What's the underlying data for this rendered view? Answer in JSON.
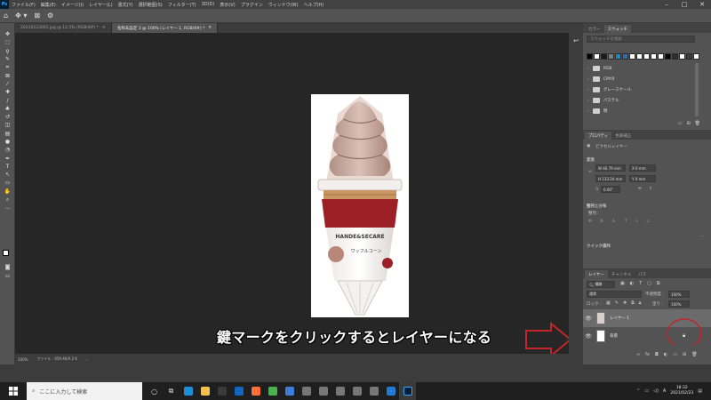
{
  "app": {
    "logo": "Ps"
  },
  "menu": [
    "ファイル(F)",
    "編集(E)",
    "イメージ(I)",
    "レイヤー(L)",
    "書式(Y)",
    "選択範囲(S)",
    "フィルター(T)",
    "3D(D)",
    "表示(V)",
    "プラグイン",
    "ウィンドウ(W)",
    "ヘルプ(H)"
  ],
  "tabs": [
    {
      "label": "20210223001.jpg @ 12.5% (RGB/8#) *",
      "active": false
    },
    {
      "label": "名称未設定 3 @ 100% (レイヤー 1, RGB/8#) *",
      "active": true
    }
  ],
  "toolbar_icons": [
    "move-icon",
    "marquee-icon",
    "lasso-icon",
    "quick-select-icon",
    "crop-icon",
    "frame-icon",
    "eyedropper-icon",
    "healing-icon",
    "brush-icon",
    "stamp-icon",
    "history-brush-icon",
    "eraser-icon",
    "gradient-icon",
    "blur-icon",
    "dodge-icon",
    "pen-icon",
    "type-icon",
    "path-select-icon",
    "rectangle-icon",
    "hand-icon",
    "zoom-icon",
    "more-tools-icon"
  ],
  "status": {
    "zoom": "100%",
    "file_info": "ファイル : 459.4K/0.2 K"
  },
  "swatches_panel": {
    "tabs": [
      "カラー",
      "スウォッチ"
    ],
    "search_placeholder": "スウォッチを検索",
    "colors": [
      "#000000",
      "#ffffff",
      "#1a1a1a",
      "#7e7e7e",
      "#1b8ac9",
      "#2a6fb0",
      "#ffffff",
      "#ffffff",
      "#ffffff",
      "#ffffff",
      "#ffffff",
      "#000000",
      "#2e2e2e",
      "#ffffff",
      "#3c3c3c",
      "#ffffff"
    ],
    "folders": [
      "RGB",
      "CMYK",
      "グレースケール",
      "パステル",
      "明"
    ]
  },
  "properties_panel": {
    "tabs": [
      "プロパティ",
      "色調補正"
    ],
    "layer_type": "ピクセルレイヤー",
    "transform_title": "変形",
    "width": "W 46.79 mm",
    "x": "X 0 mm",
    "height": "H 133.34 mm",
    "y": "Y 0 mm",
    "angle": "0.00°",
    "align_title": "整列と分布",
    "align_label": "整列 :",
    "quick_title": "クイック操作"
  },
  "layers_panel": {
    "tabs": [
      "レイヤー",
      "チャンネル",
      "パス"
    ],
    "filter_kind": "種類",
    "blend_mode": "通常",
    "opacity_label": "不透明度 :",
    "opacity": "100%",
    "lock_label": "ロック :",
    "fill_label": "塗り :",
    "fill": "100%",
    "layers": [
      {
        "name": "レイヤー 1",
        "selected": true
      },
      {
        "name": "背景",
        "selected": false
      }
    ]
  },
  "annotation": {
    "caption": "鍵マークをクリックするとレイヤーになる",
    "accent": "#c0262b"
  },
  "taskbar": {
    "search_placeholder": "ここに入力して検索",
    "apps": [
      "cortana-icon",
      "task-view-icon",
      "edge-icon",
      "explorer-icon",
      "store-icon",
      "mail-icon",
      "firefox-icon",
      "chrome-icon",
      "photos-icon",
      "app-icon",
      "app-icon",
      "app-icon",
      "app-icon",
      "app-icon",
      "vscode-icon",
      "photoshop-icon"
    ],
    "ime": "A",
    "time": "18:32",
    "date": "2021/02/23"
  }
}
